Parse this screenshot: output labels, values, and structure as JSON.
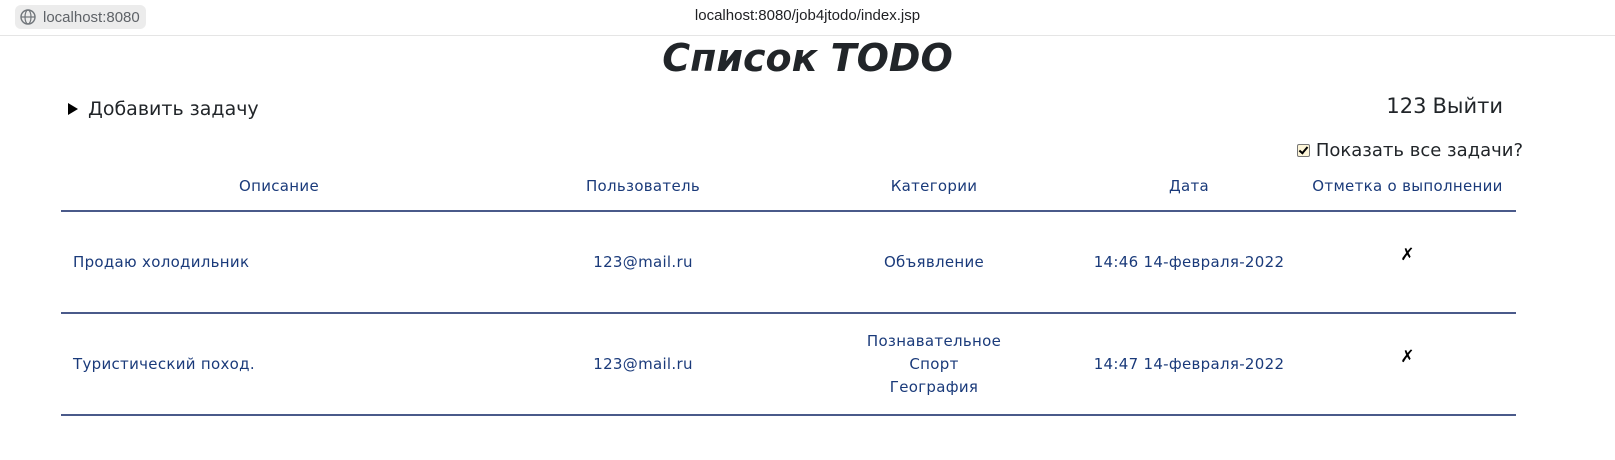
{
  "browser": {
    "site_chip": "localhost:8080",
    "url": "localhost:8080/job4jtodo/index.jsp"
  },
  "page": {
    "title": "Список TODO",
    "add_task_label": "Добавить задачу",
    "user_name": "123",
    "logout_label": "Выйти",
    "show_all_label": "Показать все задачи?",
    "show_all_checked": true
  },
  "table": {
    "headers": [
      "Описание",
      "Пользователь",
      "Категории",
      "Дата",
      "Отметка о выполнении"
    ],
    "rows": [
      {
        "description": "Продаю холодильник",
        "user": "123@mail.ru",
        "categories": [
          "Объявление"
        ],
        "date": "14:46 14-февраля-2022",
        "done_mark": "✗"
      },
      {
        "description": "Туристический поход.",
        "user": "123@mail.ru",
        "categories": [
          "Познавательное",
          "Спорт",
          "География"
        ],
        "date": "14:47 14-февраля-2022",
        "done_mark": "✗"
      }
    ]
  },
  "colors": {
    "table_text": "#1a3a7a",
    "table_border": "#4a5a8a",
    "title": "#212529"
  }
}
